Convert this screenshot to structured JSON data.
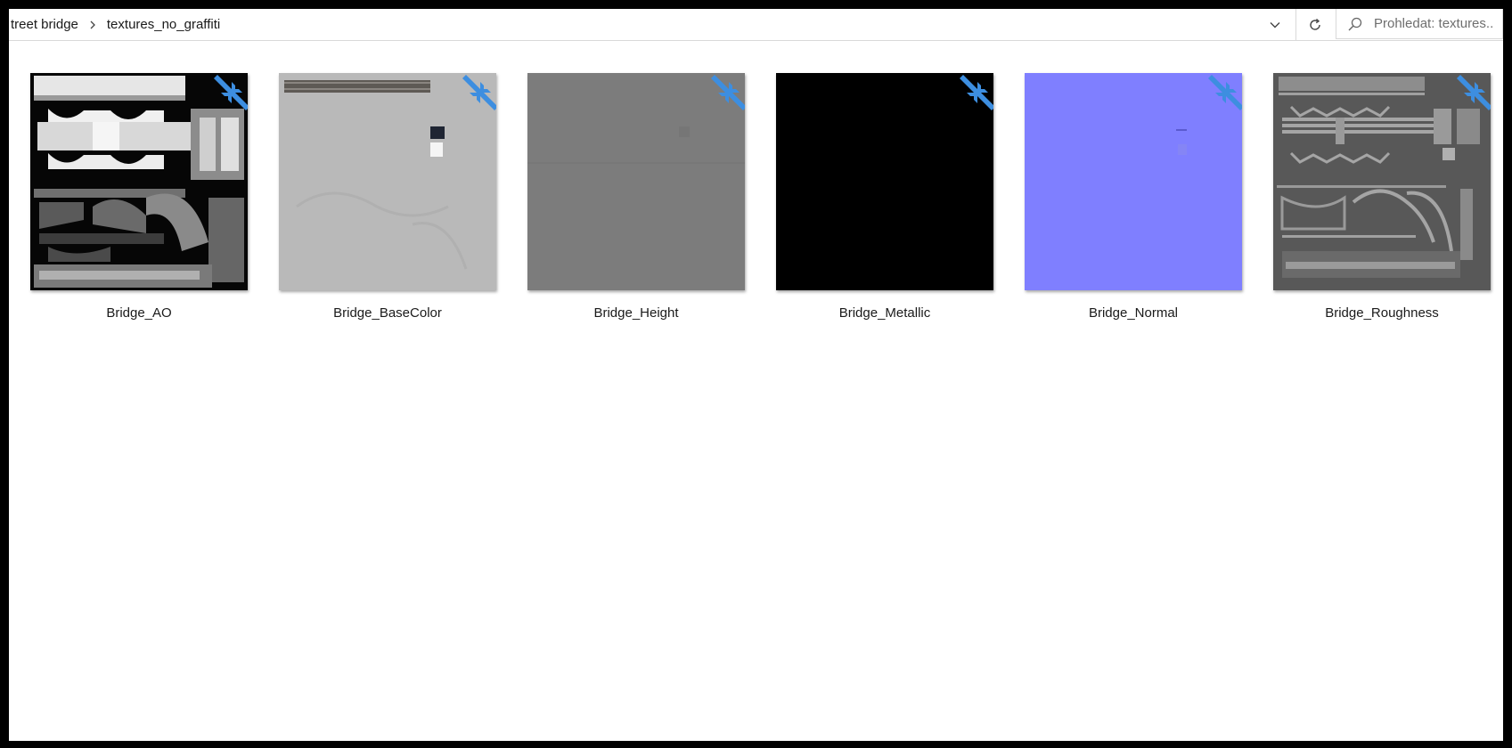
{
  "address_bar": {
    "breadcrumbs": [
      "treet bridge",
      "textures_no_graffiti"
    ],
    "search_placeholder": "Prohledat: textures..."
  },
  "files": [
    {
      "name": "Bridge_AO",
      "thumbnail": "ao-map",
      "badge_icon": "compressed-arrows-icon"
    },
    {
      "name": "Bridge_BaseColor",
      "thumbnail": "light-gray-map",
      "badge_icon": "compressed-arrows-icon"
    },
    {
      "name": "Bridge_Height",
      "thumbnail": "mid-gray-map",
      "badge_icon": "compressed-arrows-icon"
    },
    {
      "name": "Bridge_Metallic",
      "thumbnail": "black-map",
      "badge_icon": "compressed-arrows-icon"
    },
    {
      "name": "Bridge_Normal",
      "thumbnail": "normal-map",
      "badge_icon": "compressed-arrows-icon"
    },
    {
      "name": "Bridge_Roughness",
      "thumbnail": "roughness-map",
      "badge_icon": "compressed-arrows-icon"
    }
  ],
  "colors": {
    "badge_blue": "#3d8ee0",
    "normal_map": "#7f7fff",
    "height_map": "#7c7c7c",
    "basecolor_map": "#b9b9b9",
    "roughness_map": "#585858"
  }
}
